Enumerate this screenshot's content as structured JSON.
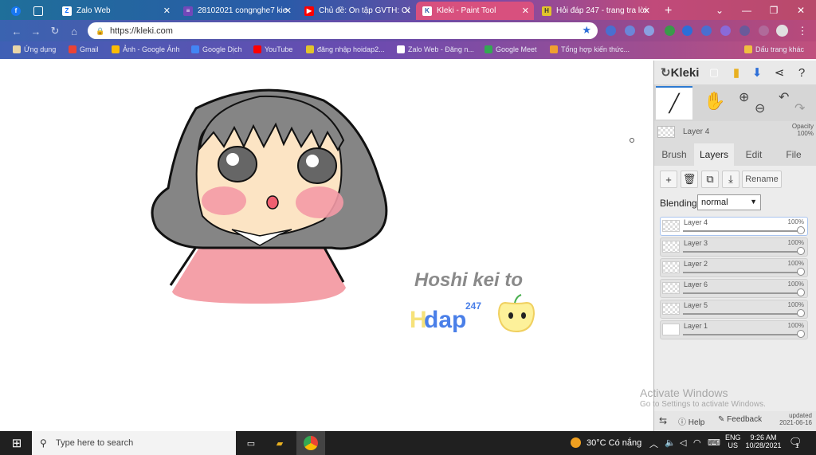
{
  "browser": {
    "tabs": [
      {
        "label": "Zalo Web",
        "icon": "zalo-icon"
      },
      {
        "label": "28102021 congnghe7 kie",
        "icon": "doc-icon"
      },
      {
        "label": "Chủ đề: Ôn tập GVTH: Cô",
        "icon": "youtube-icon"
      },
      {
        "label": "Kleki - Paint Tool",
        "icon": "kleki-icon"
      },
      {
        "label": "Hỏi đáp 247 - trang tra lời",
        "icon": "hoidap-icon"
      }
    ],
    "new_tab": "+",
    "url": "https://kleki.com",
    "bookmarks": [
      {
        "label": "Ứng dụng"
      },
      {
        "label": "Gmail"
      },
      {
        "label": "Ảnh - Google Ảnh"
      },
      {
        "label": "Google Dịch"
      },
      {
        "label": "YouTube"
      },
      {
        "label": "đăng nhập hoidap2..."
      },
      {
        "label": "Zalo Web - Đăng n..."
      },
      {
        "label": "Google Meet"
      },
      {
        "label": "Tổng hợp kiến thức..."
      },
      {
        "label": "Dấu trang khác"
      }
    ]
  },
  "kleki": {
    "logo": "Kleki",
    "current_layer": "Layer 4",
    "opacity_label": "Opacity",
    "opacity_value": "100%",
    "tabs": [
      "Brush",
      "Layers",
      "Edit",
      "File"
    ],
    "rename": "Rename",
    "blending_label": "Blending",
    "blending_value": "normal",
    "layers": [
      {
        "name": "Layer 4",
        "opacity": "100%",
        "selected": true
      },
      {
        "name": "Layer 3",
        "opacity": "100%",
        "selected": false
      },
      {
        "name": "Layer 2",
        "opacity": "100%",
        "selected": false
      },
      {
        "name": "Layer 6",
        "opacity": "100%",
        "selected": false
      },
      {
        "name": "Layer 5",
        "opacity": "100%",
        "selected": false
      },
      {
        "name": "Layer 1",
        "opacity": "100%",
        "selected": false
      }
    ],
    "help": "Help",
    "feedback": "Feedback",
    "updated_label": "updated",
    "updated_date": "2021-06-16"
  },
  "canvas": {
    "signature": "Hoshi kei to",
    "brand_h": "H",
    "brand_rest": "dap",
    "brand_sup": "247"
  },
  "watermark": {
    "line1": "Activate Windows",
    "line2": "Go to Settings to activate Windows."
  },
  "taskbar": {
    "search_placeholder": "Type here to search",
    "weather": "30°C Có nắng",
    "lang": "ENG",
    "region": "US",
    "time": "9:26 AM",
    "date": "10/28/2021",
    "notifications": "1"
  }
}
